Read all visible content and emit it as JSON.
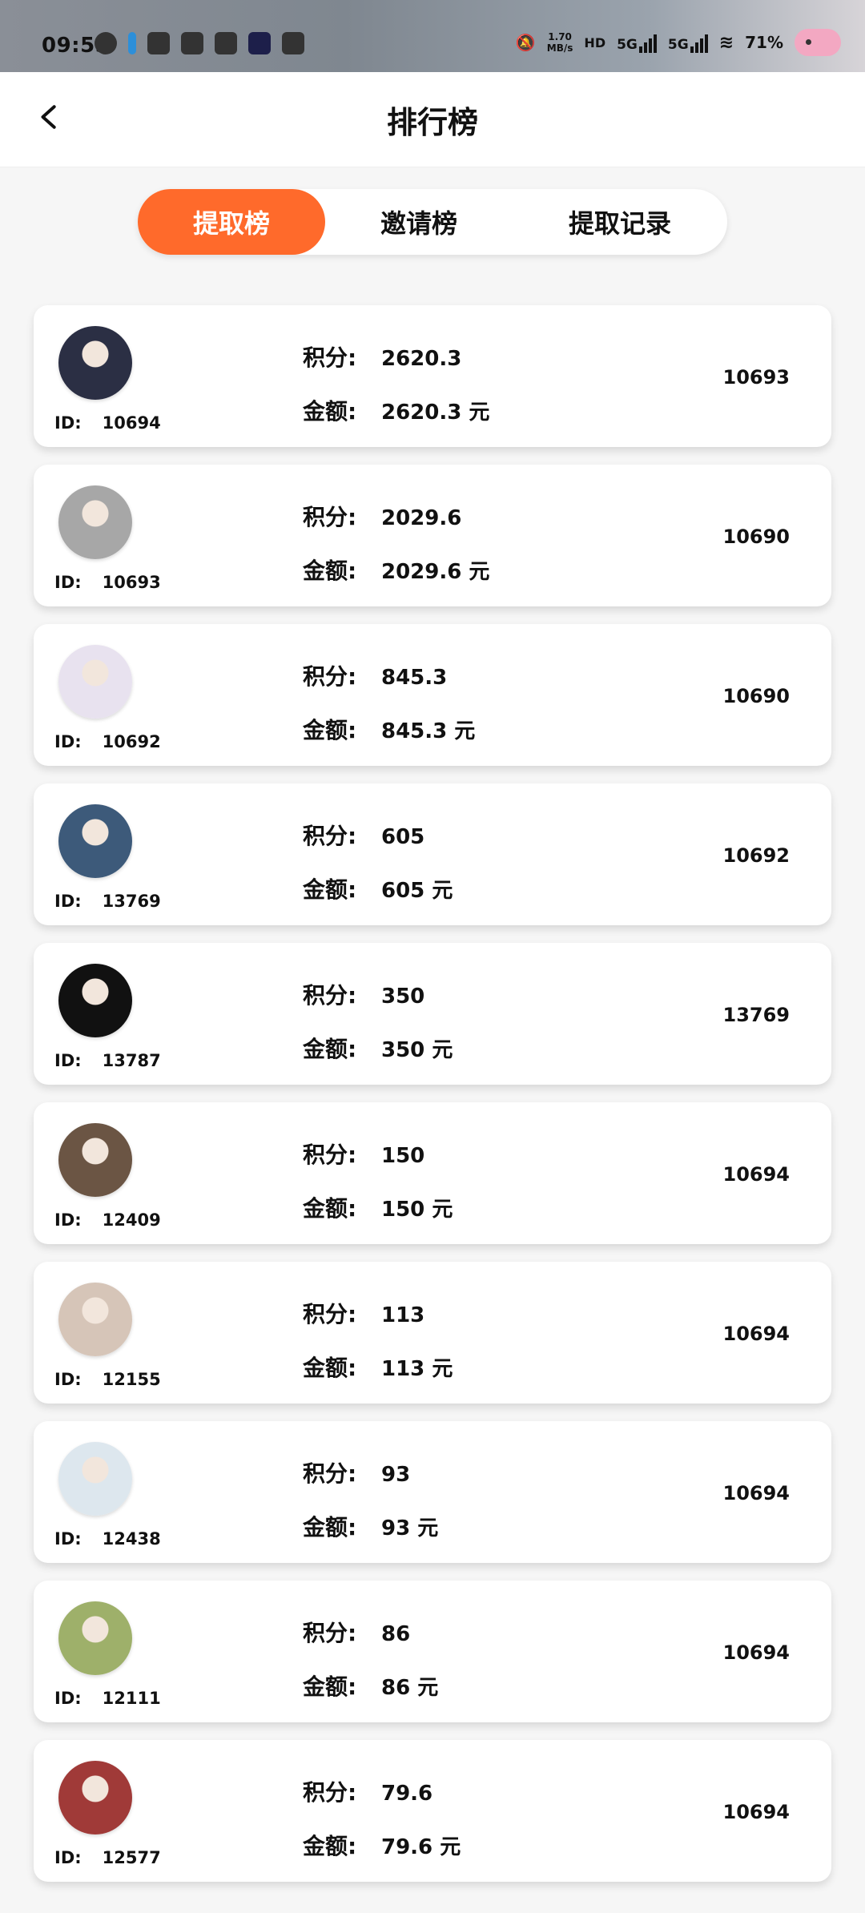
{
  "status_bar": {
    "time": "09:55",
    "net_speed": "1.70",
    "net_unit": "MB/s",
    "sig1_label": "5G",
    "sig2_label": "5G",
    "battery": "71%"
  },
  "header": {
    "title": "排行榜"
  },
  "tabs": [
    {
      "label": "提取榜"
    },
    {
      "label": "邀请榜"
    },
    {
      "label": "提取记录"
    }
  ],
  "labels": {
    "id": "ID:",
    "points": "积分:",
    "amount": "金额:",
    "yuan": "元"
  },
  "records": [
    {
      "id": "10694",
      "points": "2620.3",
      "amount": "2620.3 元",
      "ref": "10693",
      "avatar_color": "#2b2f44"
    },
    {
      "id": "10693",
      "points": "2029.6",
      "amount": "2029.6 元",
      "ref": "10690",
      "avatar_color": "#a7a7a7"
    },
    {
      "id": "10692",
      "points": "845.3",
      "amount": "845.3 元",
      "ref": "10690",
      "avatar_color": "#e8e2ef"
    },
    {
      "id": "13769",
      "points": "605",
      "amount": "605 元",
      "ref": "10692",
      "avatar_color": "#3d5a7a"
    },
    {
      "id": "13787",
      "points": "350",
      "amount": "350 元",
      "ref": "13769",
      "avatar_color": "#111111"
    },
    {
      "id": "12409",
      "points": "150",
      "amount": "150 元",
      "ref": "10694",
      "avatar_color": "#6b5544"
    },
    {
      "id": "12155",
      "points": "113",
      "amount": "113 元",
      "ref": "10694",
      "avatar_color": "#d6c5b8"
    },
    {
      "id": "12438",
      "points": "93",
      "amount": "93 元",
      "ref": "10694",
      "avatar_color": "#dde7ee"
    },
    {
      "id": "12111",
      "points": "86",
      "amount": "86 元",
      "ref": "10694",
      "avatar_color": "#9eb06a"
    },
    {
      "id": "12577",
      "points": "79.6",
      "amount": "79.6 元",
      "ref": "10694",
      "avatar_color": "#a03a38"
    }
  ]
}
